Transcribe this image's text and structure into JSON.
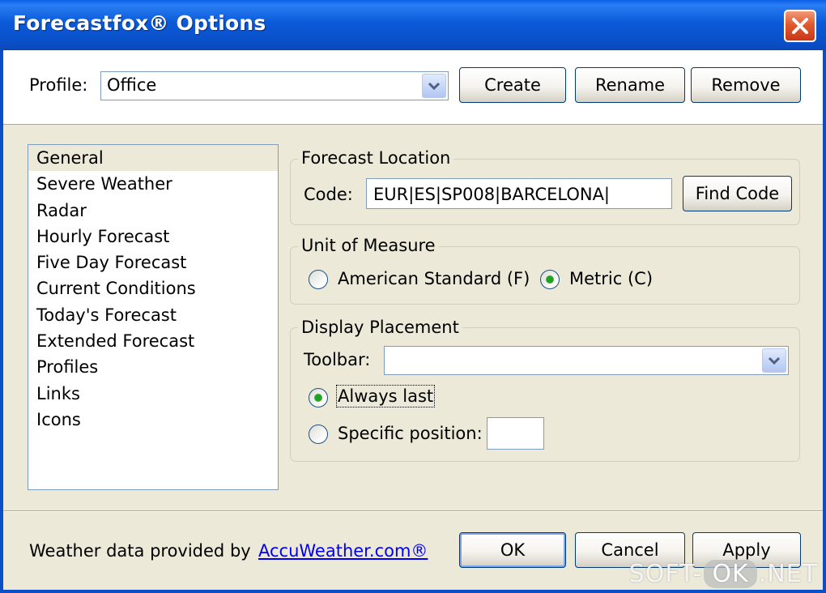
{
  "window": {
    "title": "Forecastfox® Options",
    "close_symbol": "✕"
  },
  "profile": {
    "label": "Profile:",
    "selected": "Office",
    "buttons": {
      "create": "Create",
      "rename": "Rename",
      "remove": "Remove"
    }
  },
  "sidebar": {
    "items": [
      {
        "label": "General",
        "selected": true
      },
      {
        "label": "Severe Weather"
      },
      {
        "label": "Radar"
      },
      {
        "label": "Hourly Forecast"
      },
      {
        "label": "Five Day Forecast"
      },
      {
        "label": "Current Conditions"
      },
      {
        "label": "Today's Forecast"
      },
      {
        "label": "Extended Forecast"
      },
      {
        "label": "Profiles"
      },
      {
        "label": "Links"
      },
      {
        "label": "Icons"
      }
    ]
  },
  "forecast_location": {
    "title": "Forecast Location",
    "code_label": "Code:",
    "code_value": "EUR|ES|SP008|BARCELONA|",
    "find_code": "Find Code"
  },
  "unit_of_measure": {
    "title": "Unit of Measure",
    "options": [
      {
        "label": "American Standard (F)",
        "checked": false
      },
      {
        "label": "Metric (C)",
        "checked": true
      }
    ]
  },
  "display_placement": {
    "title": "Display Placement",
    "toolbar_label": "Toolbar:",
    "toolbar_value": "",
    "always_last": "Always last",
    "always_last_checked": true,
    "specific_position": "Specific position:",
    "specific_position_checked": false,
    "position_value": ""
  },
  "footer": {
    "provided_by": "Weather data provided by",
    "link": "AccuWeather.com®",
    "ok": "OK",
    "cancel": "Cancel",
    "apply": "Apply"
  },
  "watermark": {
    "left": "SOFT-",
    "middle": "OK",
    "right": ".NET"
  },
  "colors": {
    "titlebar": "#0a4fc8",
    "dialog_bg": "#ece9d8",
    "radio_dot": "#21a121",
    "link": "#0000ee"
  }
}
